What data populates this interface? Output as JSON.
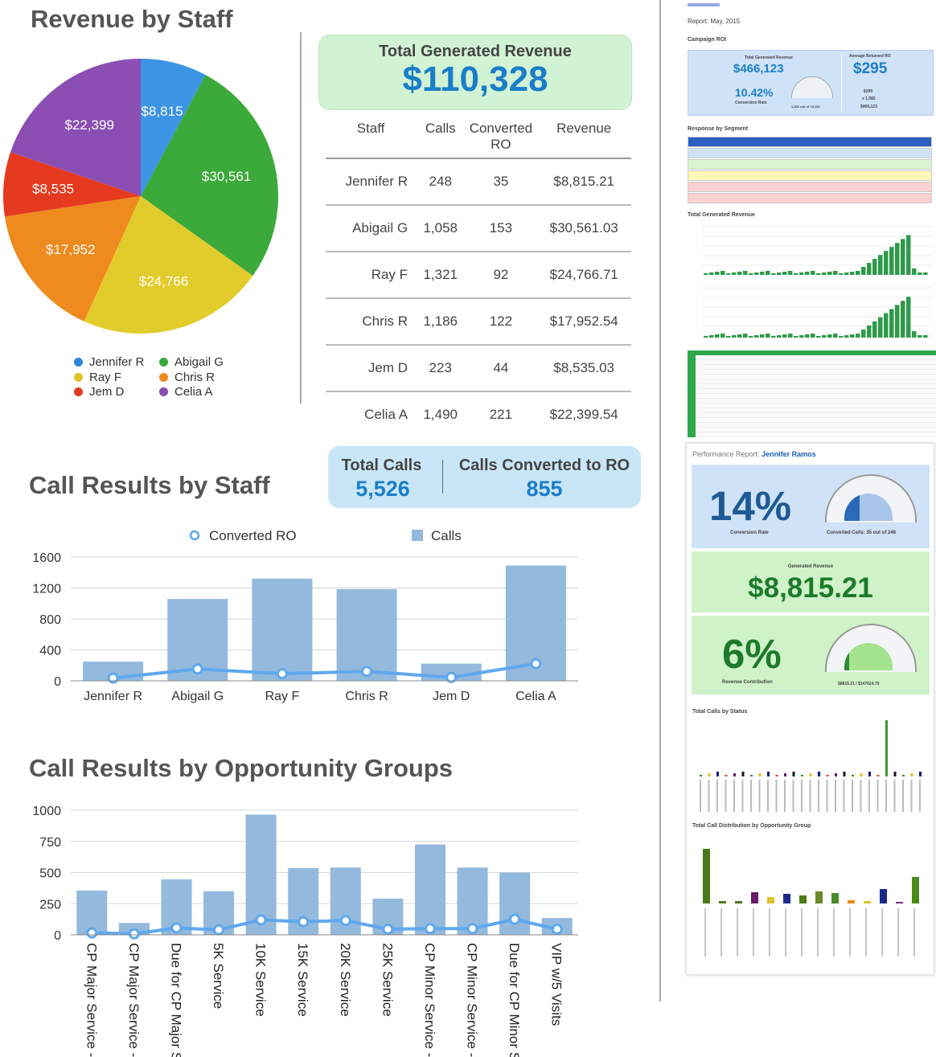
{
  "revenue_section": {
    "title": "Revenue by Staff",
    "total_box": {
      "label": "Total Generated Revenue",
      "value": "$110,328"
    },
    "table": {
      "headers": [
        "Staff",
        "Calls",
        "Converted RO",
        "Revenue"
      ],
      "rows": [
        [
          "Jennifer R",
          "248",
          "35",
          "$8,815.21"
        ],
        [
          "Abigail G",
          "1,058",
          "153",
          "$30,561.03"
        ],
        [
          "Ray F",
          "1,321",
          "92",
          "$24,766.71"
        ],
        [
          "Chris R",
          "1,186",
          "122",
          "$17,952.54"
        ],
        [
          "Jem D",
          "223",
          "44",
          "$8,535.03"
        ],
        [
          "Celia A",
          "1,490",
          "221",
          "$22,399.54"
        ]
      ]
    },
    "pie": {
      "type": "pie",
      "slices": [
        {
          "name": "Jennifer R",
          "value": 8815,
          "label": "$8,815",
          "color": "#3c94e4"
        },
        {
          "name": "Abigail G",
          "value": 30561,
          "label": "$30,561",
          "color": "#3caa3a"
        },
        {
          "name": "Ray F",
          "value": 24766,
          "label": "$24,766",
          "color": "#e2cc2c"
        },
        {
          "name": "Chris R",
          "value": 17952,
          "label": "$17,952",
          "color": "#ef8a1f"
        },
        {
          "name": "Jem D",
          "value": 8535,
          "label": "$8,535",
          "color": "#e53a1f"
        },
        {
          "name": "Celia A",
          "value": 22399,
          "label": "$22,399",
          "color": "#8b4fb4"
        }
      ],
      "legend": [
        {
          "label": "Jennifer R",
          "color": "#2d86dc"
        },
        {
          "label": "Abigail G",
          "color": "#36a83a"
        },
        {
          "label": "Ray F",
          "color": "#e0c22a"
        },
        {
          "label": "Chris R",
          "color": "#ee8a1c"
        },
        {
          "label": "Jem D",
          "color": "#e23a1c"
        },
        {
          "label": "Celia A",
          "color": "#8a4db5"
        }
      ]
    }
  },
  "call_section": {
    "title": "Call Results by Staff",
    "summary": {
      "calls_label": "Total Calls",
      "calls_value": "5,526",
      "converted_label": "Calls Converted to RO",
      "converted_value": "855"
    }
  },
  "group_section": {
    "title": "Call Results by Opportunity Groups"
  },
  "chart_data": [
    {
      "type": "bar",
      "categories": [
        "Jennifer R",
        "Abigail G",
        "Ray F",
        "Chris R",
        "Jem D",
        "Celia A"
      ],
      "series": [
        {
          "name": "Calls",
          "type": "bar",
          "values": [
            248,
            1058,
            1321,
            1186,
            223,
            1490
          ],
          "color": "#93b9dd"
        },
        {
          "name": "Converted RO",
          "type": "line",
          "values": [
            35,
            153,
            92,
            122,
            44,
            221
          ],
          "color": "#5fa8ee"
        }
      ],
      "yticks": [
        "0",
        "400",
        "800",
        "1200",
        "1600"
      ],
      "ylim": [
        0,
        1600
      ],
      "legend": "top-center",
      "grid": true
    },
    {
      "type": "bar",
      "categories": [
        "CP Major Service - ...",
        "CP Major Service - I...",
        "Due for CP Major Se...",
        "5K Service",
        "10K Service",
        "15K Service",
        "20K Service",
        "25K Service",
        "CP Minor Service - ...",
        "CP Minor Service - I...",
        "Due for CP Minor Se...",
        "VIP w/5 Visits"
      ],
      "series": [
        {
          "name": "Calls",
          "type": "bar",
          "values": [
            355,
            95,
            445,
            350,
            965,
            535,
            540,
            290,
            725,
            540,
            500,
            135
          ],
          "color": "#93b9dd"
        },
        {
          "name": "Converted RO",
          "type": "line",
          "values": [
            15,
            8,
            55,
            40,
            120,
            105,
            115,
            45,
            50,
            50,
            125,
            45
          ],
          "color": "#5fa8ee"
        }
      ],
      "yticks": [
        "0",
        "250",
        "500",
        "750",
        "1000"
      ],
      "ylim": [
        0,
        1000
      ],
      "grid": true
    }
  ],
  "thumbs": {
    "report_header": "Report: May, 2015",
    "campaign": {
      "title": "Campaign ROI",
      "total_label": "Total Generated Revenue",
      "total_value": "$466,123",
      "rate_value": "10.42%",
      "rate_label": "Conversion Rate",
      "calls_out": "1,582 out of 15,183",
      "avg_label": "Average Returned RO",
      "avg_value": "$295",
      "avg_small1": "$295",
      "avg_small2": "x 1,582",
      "avg_small3": "$466,123"
    },
    "segment_title": "Response by Segment",
    "tgr_title": "Total Generated Revenue",
    "perf": {
      "title": "Performance Report:",
      "name": "Jennifer Ramos",
      "conv_value": "14%",
      "conv_label": "Conversion Rate",
      "conv_calls": "Converted Calls: 35 out of 248",
      "rev_label": "Generated Revenue",
      "rev_value": "$8,815.21",
      "contrib_value": "6%",
      "contrib_label": "Revenue Contribution",
      "contrib_note": "$8815.21 / $147624.79",
      "status_title": "Total Calls by Status",
      "dist_title": "Total Call Distribution by Opportunity Group"
    }
  }
}
